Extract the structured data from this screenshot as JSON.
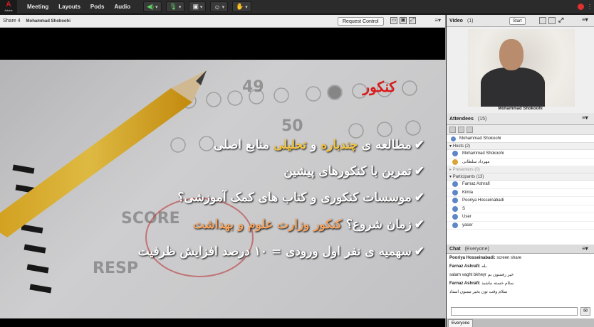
{
  "app": {
    "logo_mark": "A",
    "logo_text": "Adobe"
  },
  "menu": [
    "Meeting",
    "Layouts",
    "Pods",
    "Audio"
  ],
  "share": {
    "title": "Share 4",
    "presenter": "Mohammad Shokoohi",
    "request_control": "Request Control"
  },
  "slide": {
    "title": "کنکور",
    "lines": [
      {
        "before": "مطالعه ی ",
        "hl1": "چندباره",
        "mid": " و ",
        "hl2": "تحلیلی",
        "after": " منابع اصلی"
      },
      {
        "text": "تمرین با کنکورهای پیشین"
      },
      {
        "text": "موسسات کنکوری و کتاب های کمک آموزشی؟"
      },
      {
        "before": "زمان شروع؟ ",
        "hl": "کنکور وزارت علوم و بهداشت"
      },
      {
        "text": "سهمیه ی نفر اول ورودی = ۱۰ درصد افزایش ظرفیت"
      }
    ]
  },
  "video": {
    "title": "Video",
    "count": "(1)",
    "start": "Start",
    "caption": "Mohammad Shokoohi"
  },
  "attendees": {
    "title": "Attendees",
    "count": "(15)",
    "current_user": "Mohammad Shokoohi",
    "hosts": {
      "label": "Hosts (2)",
      "items": [
        "Mohammad Shokoohi",
        "مهرداد سلطانی"
      ]
    },
    "presenters": {
      "label": "Presenters (0)"
    },
    "participants": {
      "label": "Participants (13)",
      "items": [
        "Farnaz Ashrafi",
        "Kimia",
        "Pooriya Hosseinabadi",
        "S",
        "User",
        "yaser"
      ]
    }
  },
  "chat": {
    "title": "Chat",
    "scope": "(Everyone)",
    "messages": [
      {
        "from": "Pooriya Hosseinabadi:",
        "text": "screen share"
      },
      {
        "from": "Farnaz Ashrafi:",
        "text": "بله"
      },
      {
        "from": "",
        "text": "salam vaght bkheyr خیر رفتنتون بم"
      },
      {
        "from": "Farnaz Ashrafi:",
        "text": "سلام خسته نباشید"
      },
      {
        "from": "",
        "text": "سلام وقت تون بخیر ممنون استاد"
      }
    ],
    "tab": "Everyone"
  },
  "colors": {
    "record": "#e03030",
    "title_red": "#d91a1a",
    "highlight_yellow": "#f4c542"
  }
}
